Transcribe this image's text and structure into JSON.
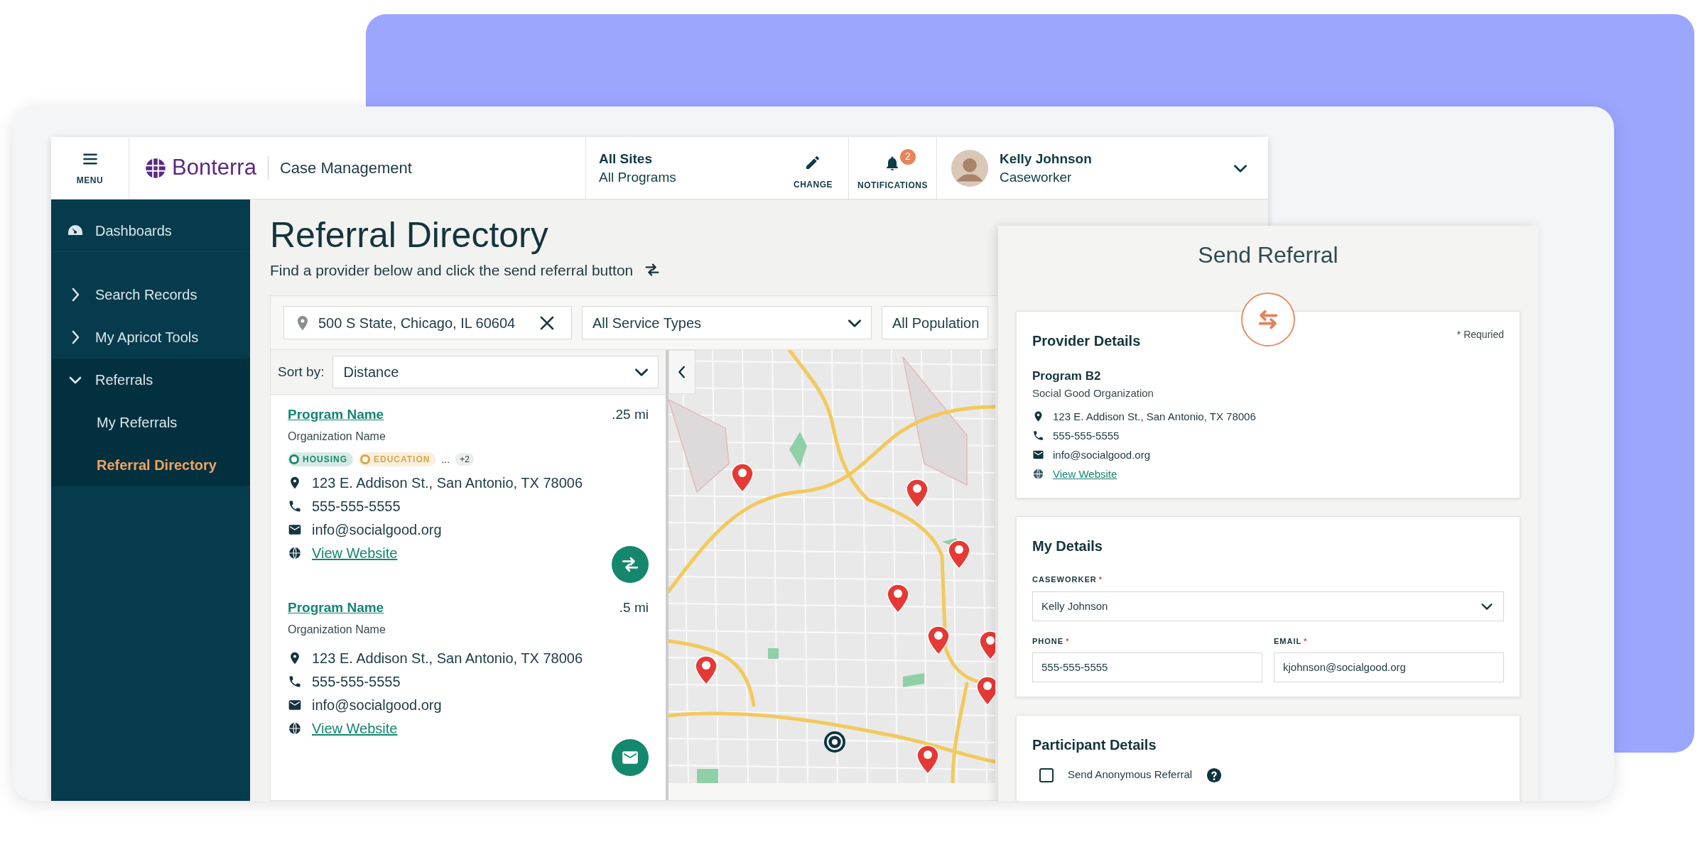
{
  "top_bar": {
    "menu_label": "MENU",
    "brand": "Bonterra",
    "product": "Case Management",
    "sites": "All Sites",
    "programs": "All Programs",
    "change_label": "CHANGE",
    "notifications_label": "NOTIFICATIONS",
    "notification_count": "2",
    "user_name": "Kelly Johnson",
    "user_role": "Caseworker"
  },
  "sidebar": {
    "items": [
      {
        "label": "Dashboards",
        "kind": "dashboard",
        "selected": false
      },
      {
        "label": "Search Records",
        "kind": "group",
        "expanded": false,
        "selected": false
      },
      {
        "label": "My Apricot Tools",
        "kind": "group",
        "expanded": false,
        "selected": false
      },
      {
        "label": "Referrals",
        "kind": "group",
        "expanded": true,
        "selected": false,
        "children": [
          {
            "label": "My Referrals",
            "selected": false
          },
          {
            "label": "Referral Directory",
            "selected": true
          }
        ]
      }
    ]
  },
  "page": {
    "title": "Referral Directory",
    "subtitle": "Find a provider below and click the send referral button"
  },
  "filters": {
    "location": "500 S State, Chicago, IL 60604",
    "service_type": "All Service Types",
    "population": "All Population"
  },
  "sort": {
    "label": "Sort by:",
    "value": "Distance"
  },
  "results": [
    {
      "program": "Program Name",
      "organization": "Organization Name",
      "distance": ".25 mi",
      "tags": [
        {
          "label": "HOUSING",
          "color": "#1a8a6e"
        },
        {
          "label": "EDUCATION",
          "color": "#dba545"
        }
      ],
      "more": "...",
      "extra_count": "+2",
      "address": "123 E. Addison St., San Antonio, TX 78006",
      "phone": "555-555-5555",
      "email": "info@socialgood.org",
      "website": "View Website",
      "kind": "refer"
    },
    {
      "program": "Program Name",
      "organization": "Organization Name",
      "distance": ".5 mi",
      "address": "123 E. Addison St., San Antonio, TX 78006",
      "phone": "555-555-5555",
      "email": "info@socialgood.org",
      "website": "View Website",
      "kind": "email"
    }
  ],
  "send_referral": {
    "title": "Send Referral",
    "provider": {
      "heading": "Provider Details",
      "required_note": "* Requried",
      "program": "Program B2",
      "organization": "Social Good Organization",
      "address": "123 E. Addison St., San Antonio, TX 78006",
      "phone": "555-555-5555",
      "email": "info@socialgood.org",
      "website": "View Website"
    },
    "my_details": {
      "heading": "My Details",
      "caseworker": {
        "label": "CASEWORKER",
        "required_mark": "*",
        "value": "Kelly Johnson"
      },
      "phone": {
        "label": "PHONE",
        "required_mark": "*",
        "value": "555-555-5555"
      },
      "email": {
        "label": "EMAIL",
        "required_mark": "*",
        "value": "kjohnson@socialgood.org"
      }
    },
    "participant": {
      "heading": "Participant Details",
      "anonymous": {
        "label": "Send Anonymous Referral",
        "checked": false
      }
    }
  }
}
